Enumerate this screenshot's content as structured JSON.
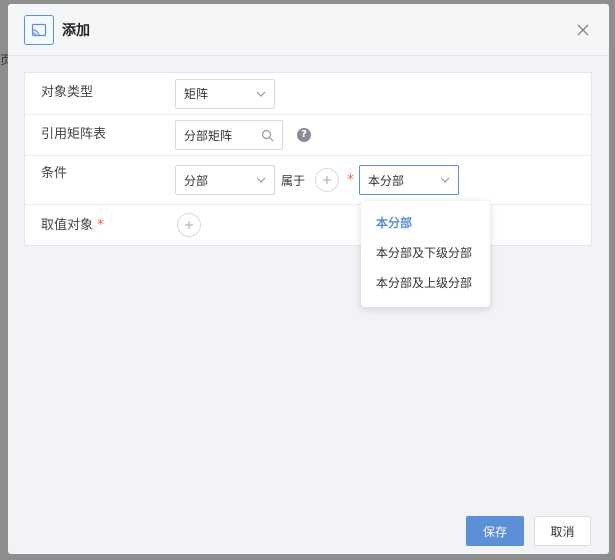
{
  "backdrop": {
    "edge_text": "页"
  },
  "dialog": {
    "title": "添加",
    "icon": "cast-icon",
    "close_icon": "close-icon"
  },
  "form": {
    "object_type": {
      "label": "对象类型",
      "value": "矩阵"
    },
    "matrix_table": {
      "label": "引用矩阵表",
      "value": "分部矩阵",
      "help": "?"
    },
    "condition": {
      "label": "条件",
      "field": "分部",
      "operator": "属于",
      "required_mark": "*",
      "value": "本分部"
    },
    "value_object": {
      "label": "取值对象",
      "required_mark": "*"
    }
  },
  "dropdown": {
    "options": [
      "本分部",
      "本分部及下级分部",
      "本分部及上级分部"
    ],
    "selected": "本分部"
  },
  "footer": {
    "save_label": "保存",
    "cancel_label": "取消"
  },
  "colors": {
    "accent": "#5d8fd8",
    "required": "#f06a4c"
  }
}
